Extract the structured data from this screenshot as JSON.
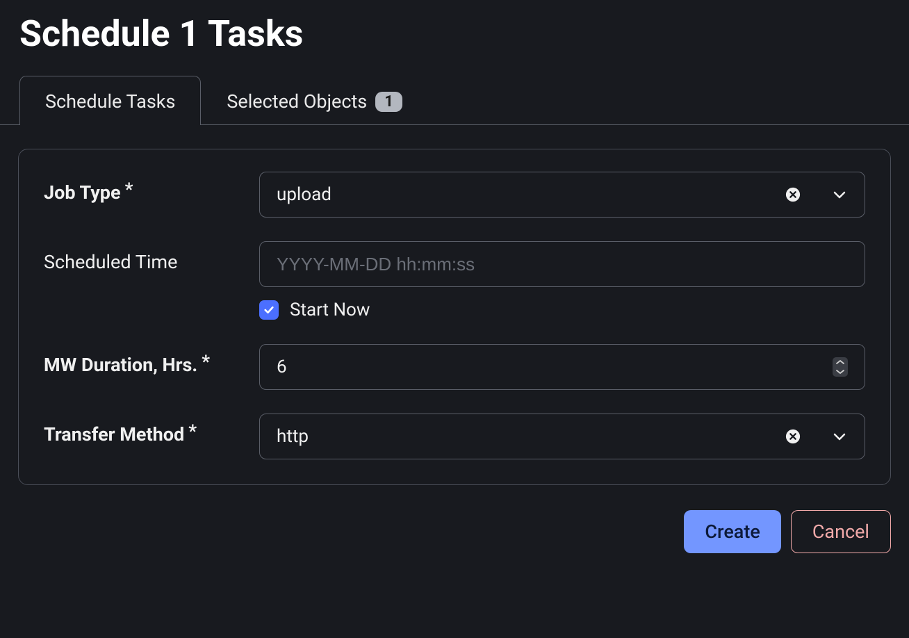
{
  "title": "Schedule 1 Tasks",
  "tabs": {
    "schedule_tasks": {
      "label": "Schedule Tasks"
    },
    "selected_objects": {
      "label": "Selected Objects",
      "count": "1"
    }
  },
  "form": {
    "job_type": {
      "label": "Job Type",
      "required": "*",
      "value": "upload"
    },
    "scheduled_time": {
      "label": "Scheduled Time",
      "placeholder": "YYYY-MM-DD hh:mm:ss",
      "value": "",
      "start_now_label": "Start Now",
      "start_now_checked": true
    },
    "mw_duration": {
      "label": "MW Duration, Hrs.",
      "required": "*",
      "value": "6"
    },
    "transfer_method": {
      "label": "Transfer Method",
      "required": "*",
      "value": "http"
    }
  },
  "actions": {
    "create": "Create",
    "cancel": "Cancel"
  }
}
